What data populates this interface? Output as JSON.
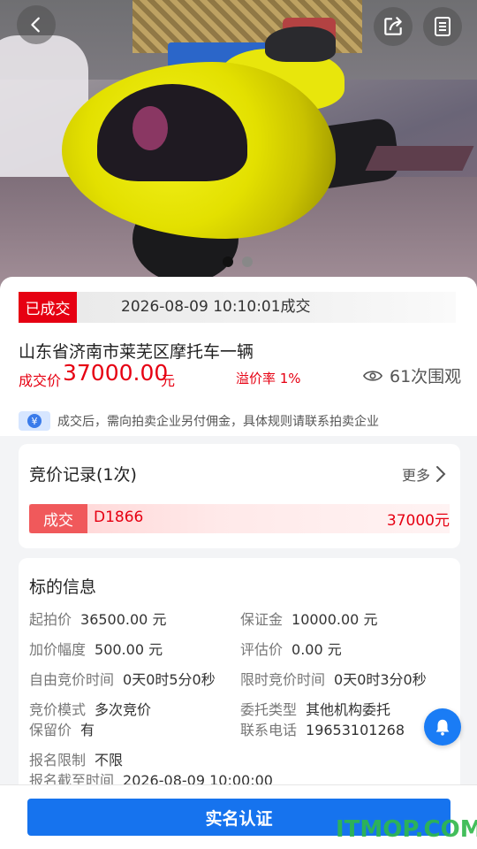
{
  "status": {
    "badge": "已成交",
    "time": "2026-08-09 10:10:01成交"
  },
  "item": {
    "title": "山东省济南市莱芜区摩托车一辆",
    "price_label": "成交价",
    "price_value": "37000.00",
    "price_unit": "元",
    "premium": "溢价率 1%",
    "views": "61次围观"
  },
  "notice": {
    "text": "成交后，需向拍卖企业另付佣金，具体规则请联系拍卖企业",
    "icon": "yen-icon"
  },
  "bids": {
    "title": "竞价记录(1次)",
    "more": "更多",
    "records": [
      {
        "badge": "成交",
        "user": "D1866",
        "price": "37000元"
      }
    ]
  },
  "info": {
    "title": "标的信息",
    "fields": [
      {
        "key": "起拍价",
        "value": "36500.00 元"
      },
      {
        "key": "保证金",
        "value": "10000.00 元"
      },
      {
        "key": "加价幅度",
        "value": "500.00 元"
      },
      {
        "key": "评估价",
        "value": "0.00 元"
      },
      {
        "key": "自由竞价时间",
        "value": "0天0时5分0秒"
      },
      {
        "key": "限时竞价时间",
        "value": "0天0时3分0秒"
      },
      {
        "key": "竞价模式",
        "value": "多次竞价"
      },
      {
        "key": "委托类型",
        "value": "其他机构委托"
      },
      {
        "key": "保留价",
        "value": "有"
      },
      {
        "key": "联系电话",
        "value": "19653101268"
      },
      {
        "key": "报名限制",
        "value": "不限"
      },
      {
        "key": "报名截至时间",
        "value": "2026-08-09 10:00:00"
      }
    ]
  },
  "carousel": {
    "total": 2,
    "active": 1
  },
  "actions": {
    "verify": "实名认证"
  },
  "watermark": "ITMOP.COM",
  "colors": {
    "accent": "#1673ee",
    "price": "#e60012",
    "badge": "#e60012"
  }
}
